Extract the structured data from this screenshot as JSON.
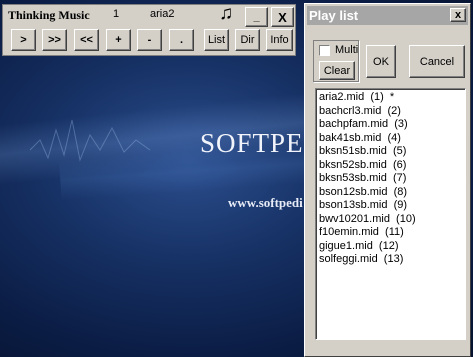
{
  "player": {
    "title": "Thinking Music",
    "track_number": "1",
    "track_name": "aria2",
    "note_symbol": "♫",
    "minimize_label": "_",
    "close_label": "X",
    "controls": [
      ">",
      ">>",
      "<<",
      "+",
      "-",
      "."
    ],
    "list_label": "List",
    "dir_label": "Dir",
    "info_label": "Info"
  },
  "playlist": {
    "title": "Play list",
    "close_label": "x",
    "multi_label": "Multi",
    "clear_label": "Clear",
    "ok_label": "OK",
    "cancel_label": "Cancel",
    "items": [
      "aria2.mid  (1)  *",
      "bachcrl3.mid  (2)",
      "bachpfam.mid  (3)",
      "bak41sb.mid  (4)",
      "bksn51sb.mid  (5)",
      "bksn52sb.mid  (6)",
      "bksn53sb.mid  (7)",
      "bson12sb.mid  (8)",
      "bson13sb.mid  (9)",
      "bwv10201.mid  (10)",
      "f10emin.mid  (11)",
      "gigue1.mid  (12)",
      "solfeggi.mid  (13)"
    ]
  },
  "background": {
    "brand": "SOFTPE",
    "url": "www.softpedi"
  }
}
